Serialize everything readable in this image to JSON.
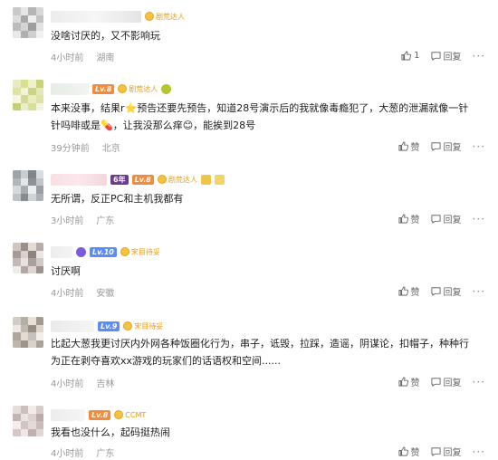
{
  "comments": [
    {
      "level": "",
      "badge": "剧荒达人",
      "text": "没啥讨厌的，又不影响玩",
      "time": "4小时前",
      "location": "湖南",
      "like_label": "1",
      "reply_label": "回复"
    },
    {
      "level": "Lv.8",
      "badge": "剧荒达人",
      "text": "本来没事，结果r⭐预告还要先预告，知道28号演示后的我就像毒瘾犯了，大葱的泄漏就像一针针吗啡或是💊，让我没那么痒😊，能挨到28号",
      "time": "39分钟前",
      "location": "北京",
      "like_label": "赞",
      "reply_label": "回复"
    },
    {
      "level": "Lv.8",
      "tenure": "6年",
      "badge": "剧荒达人",
      "text": "无所谓，反正PC和主机我都有",
      "time": "3小时前",
      "location": "广东",
      "like_label": "赞",
      "reply_label": "回复"
    },
    {
      "level": "Lv.10",
      "badge": "宋目待妥",
      "text": "讨厌啊",
      "time": "4小时前",
      "location": "安徽",
      "like_label": "赞",
      "reply_label": "回复"
    },
    {
      "level": "Lv.9",
      "badge": "宋目待妥",
      "text": "比起大葱我更讨厌内外网各种饭圈化行为，串子，诋毁，拉踩，造谣，阴谋论，扣帽子，种种行为正在剥夺喜欢xx游戏的玩家们的话语权和空间......",
      "time": "4小时前",
      "location": "吉林",
      "like_label": "赞",
      "reply_label": "回复"
    },
    {
      "level": "Lv.8",
      "badge": "CCMT",
      "text": "我看也没什么，起码挺热闹",
      "time": "4小时前",
      "location": "广东",
      "like_label": "赞",
      "reply_label": "回复"
    }
  ],
  "colors": {
    "level_blue": "#5b8df5",
    "level_orange": "#f58a3c",
    "badge_gold": "#e79a12",
    "meta_gray": "#999999"
  },
  "icons": {
    "like": "thumb-up-icon",
    "reply": "comment-bubble-icon",
    "more": "ellipsis-icon",
    "medal": "medal-icon"
  }
}
